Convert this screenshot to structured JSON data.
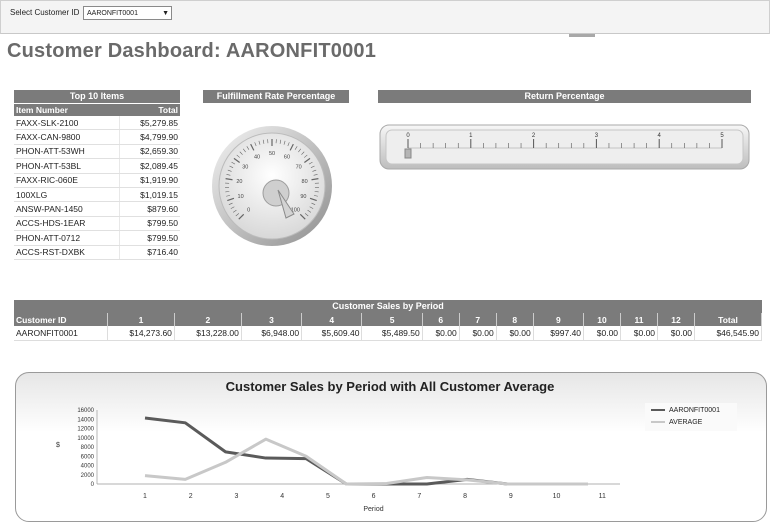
{
  "header": {
    "select_label": "Select Customer ID",
    "select_value": "AARONFIT0001"
  },
  "title": "Customer Dashboard: AARONFIT0001",
  "top_items": {
    "title": "Top 10 Items",
    "col_item": "Item Number",
    "col_total": "Total",
    "rows": [
      {
        "item": "FAXX-SLK-2100",
        "total": "$5,279.85"
      },
      {
        "item": "FAXX-CAN-9800",
        "total": "$4,799.90"
      },
      {
        "item": "PHON-ATT-53WH",
        "total": "$2,659.30"
      },
      {
        "item": "PHON-ATT-53BL",
        "total": "$2,089.45"
      },
      {
        "item": "FAXX-RIC-060E",
        "total": "$1,919.90"
      },
      {
        "item": "100XLG",
        "total": "$1,019.15"
      },
      {
        "item": "ANSW-PAN-1450",
        "total": "$879.60"
      },
      {
        "item": "ACCS-HDS-1EAR",
        "total": "$799.50"
      },
      {
        "item": "PHON-ATT-0712",
        "total": "$799.50"
      },
      {
        "item": "ACCS-RST-DXBK",
        "total": "$716.40"
      }
    ]
  },
  "fulfillment": {
    "title": "Fulfillment Rate Percentage",
    "ticks": [
      "0",
      "10",
      "20",
      "30",
      "40",
      "50",
      "60",
      "70",
      "80",
      "90",
      "100"
    ],
    "value": 100
  },
  "return_pct": {
    "title": "Return Percentage",
    "ticks": [
      "0",
      "1",
      "2",
      "3",
      "4",
      "5"
    ],
    "value": 0
  },
  "sales_table": {
    "title": "Customer Sales by Period",
    "columns": [
      "Customer ID",
      "1",
      "2",
      "3",
      "4",
      "5",
      "6",
      "7",
      "8",
      "9",
      "10",
      "11",
      "12",
      "Total"
    ],
    "row": [
      "AARONFIT0001",
      "$14,273.60",
      "$13,228.00",
      "$6,948.00",
      "$5,609.40",
      "$5,489.50",
      "$0.00",
      "$0.00",
      "$0.00",
      "$997.40",
      "$0.00",
      "$0.00",
      "$0.00",
      "$46,545.90"
    ]
  },
  "chart_data": {
    "type": "line",
    "title": "Customer Sales by Period with All Customer Average",
    "xlabel": "Period",
    "ylabel": "$",
    "x": [
      1,
      2,
      3,
      4,
      5,
      6,
      7,
      8,
      9,
      10,
      11,
      12
    ],
    "y_ticks": [
      0,
      2000,
      4000,
      6000,
      8000,
      10000,
      12000,
      14000,
      16000
    ],
    "ylim": [
      0,
      16000
    ],
    "legend_position": "right",
    "series": [
      {
        "name": "AARONFIT0001",
        "color": "#5a5a5a",
        "values": [
          14273.6,
          13228,
          6948,
          5609.4,
          5489.5,
          0,
          0,
          0,
          997.4,
          0,
          0,
          0
        ]
      },
      {
        "name": "AVERAGE",
        "color": "#c8c8c8",
        "values": [
          1800,
          1000,
          4700,
          9700,
          6000,
          0,
          100,
          1400,
          900,
          0,
          0,
          0
        ]
      }
    ]
  }
}
